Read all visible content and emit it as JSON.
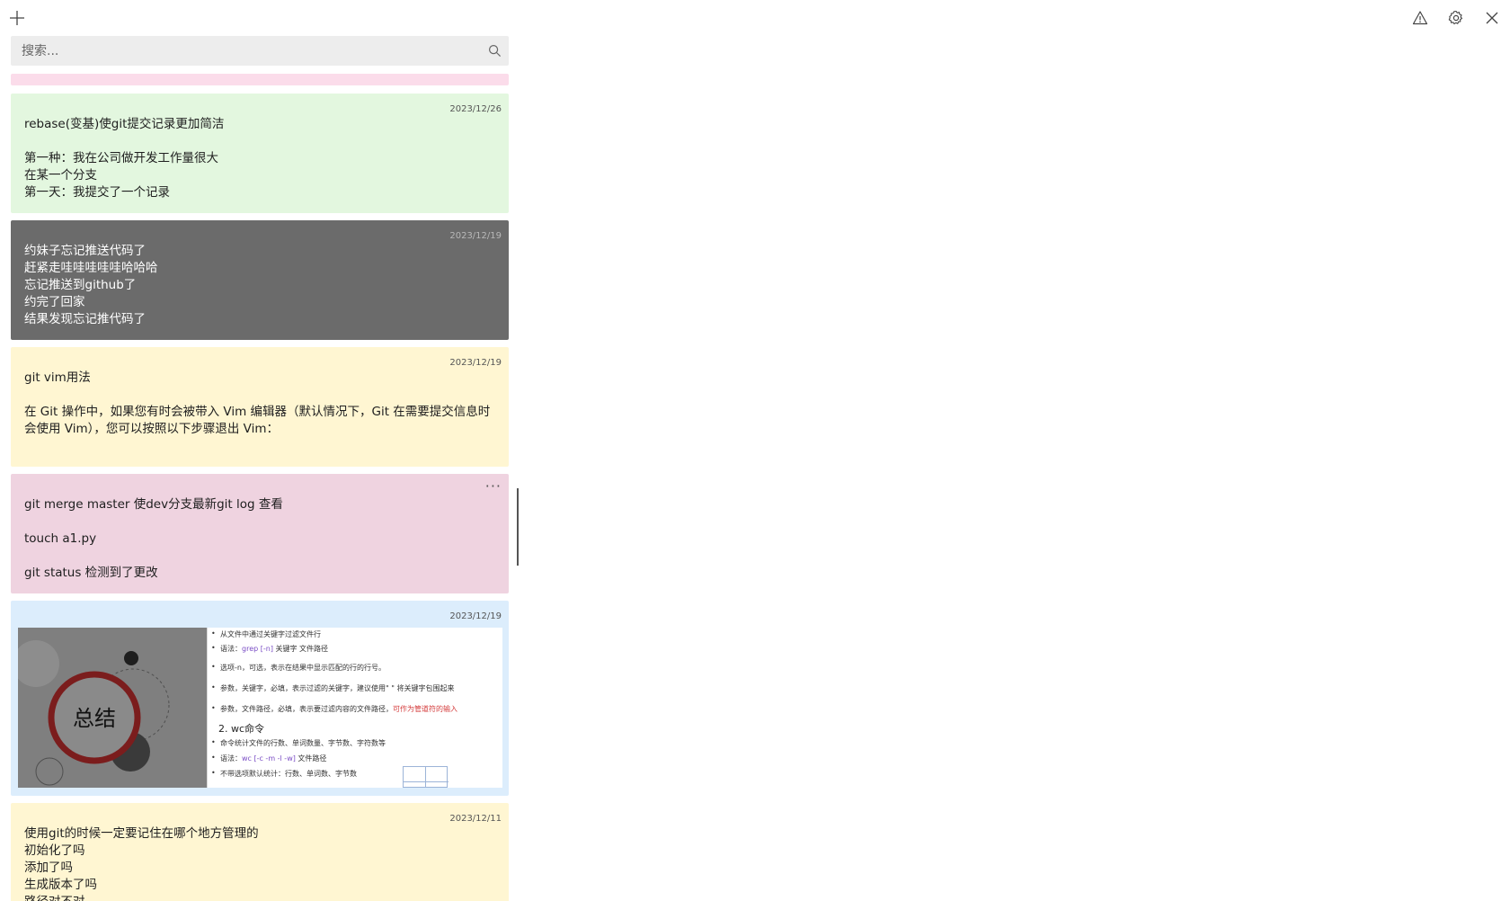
{
  "titlebar": {
    "add_icon": "plus-icon",
    "warning_icon": "warning-icon",
    "settings_icon": "gear-icon",
    "close_icon": "close-icon"
  },
  "search": {
    "placeholder": "搜索...",
    "icon": "search-icon"
  },
  "colors": {
    "pink": "#fbdcea",
    "green": "#e3f7df",
    "charcoal": "#6b6b6b",
    "yellow": "#fff6d2",
    "mauve": "#efd3e0",
    "blue": "#dcedfc"
  },
  "notes": [
    {
      "date": "",
      "text": ""
    },
    {
      "date": "2023/12/26",
      "text": "rebase(变基)使git提交记录更加简洁\n\n第一种：我在公司做开发工作量很大\n在某一个分支\n第一天：我提交了一个记录"
    },
    {
      "date": "2023/12/19",
      "text": "约妹子忘记推送代码了\n赶紧走哇哇哇哇哇哈哈哈\n忘记推送到github了\n约完了回家\n结果发现忘记推代码了"
    },
    {
      "date": "2023/12/19",
      "text": "git vim用法\n\n在 Git 操作中，如果您有时会被带入 Vim 编辑器（默认情况下，Git 在需要提交信息时会使用 Vim），您可以按照以下步骤退出 Vim："
    },
    {
      "date": "",
      "menu": "···",
      "text": "git merge master 使dev分支最新git log 查看\n\ntouch a1.py\n\ngit status 检测到了更改"
    },
    {
      "date": "2023/12/19",
      "image": {
        "left_title": "总结",
        "lines": {
          "l1": "从文件中通过关键字过滤文件行",
          "l2_prefix": "语法：",
          "l2_code": "grep [-n]",
          "l2_suffix": " 关键字 文件路径",
          "l3": "选项-n，可选，表示在结果中显示匹配的行的行号。",
          "l4": "参数，关键字，必填，表示过滤的关键字，建议使用\" \" 将关键字包围起来",
          "l5_prefix": "参数，文件路径，必填，表示要过滤内容的文件路径，",
          "l5_red": "可作为管道符的输入",
          "h2": "2. wc命令",
          "l6": "命令统计文件的行数、单词数量、字节数、字符数等",
          "l7_prefix": "语法：",
          "l7_code": "wc [-c -m -l -w]",
          "l7_suffix": " 文件路径",
          "l8": "不带选项默认统计：行数、单词数、字节数"
        }
      }
    },
    {
      "date": "2023/12/11",
      "text": "使用git的时候一定要记住在哪个地方管理的\n初始化了吗\n添加了吗\n生成版本了吗\n路径对不对"
    }
  ]
}
